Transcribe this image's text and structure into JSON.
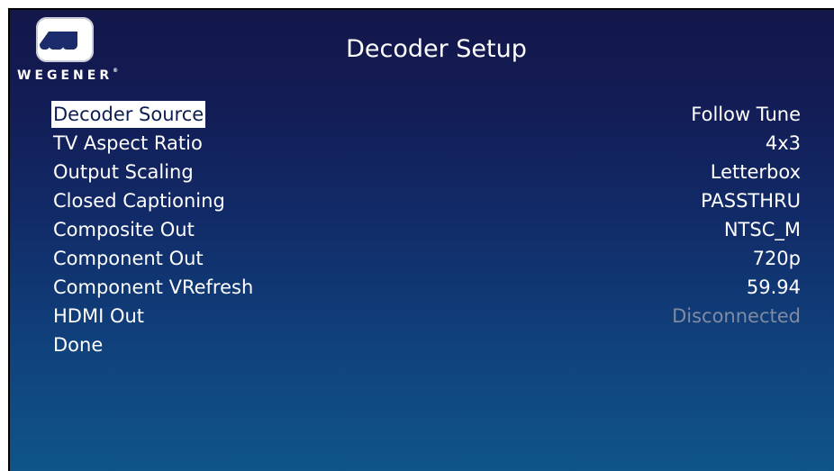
{
  "brand": {
    "name": "WEGENER",
    "mark": "®",
    "logo_icon": "wegener-double-u-logo"
  },
  "screen": {
    "title": "Decoder Setup"
  },
  "menu": {
    "selected_index": 0,
    "items": [
      {
        "label": "Decoder Source",
        "value": "Follow Tune",
        "enabled": true
      },
      {
        "label": "TV Aspect Ratio",
        "value": "4x3",
        "enabled": true
      },
      {
        "label": "Output Scaling",
        "value": "Letterbox",
        "enabled": true
      },
      {
        "label": "Closed Captioning",
        "value": "PASSTHRU",
        "enabled": true
      },
      {
        "label": "Composite Out",
        "value": "NTSC_M",
        "enabled": true
      },
      {
        "label": "Component Out",
        "value": "720p",
        "enabled": true
      },
      {
        "label": "Component VRefresh",
        "value": "59.94",
        "enabled": true
      },
      {
        "label": "HDMI Out",
        "value": "Disconnected",
        "enabled": false
      },
      {
        "label": "Done",
        "value": "",
        "enabled": true
      }
    ]
  },
  "colors": {
    "background_top": "#13174a",
    "background_bottom": "#0f5589",
    "text": "#ffffff",
    "selected_bg": "#ffffff",
    "selected_text": "#0e1e52",
    "disabled_text": "#7f8aa3"
  }
}
